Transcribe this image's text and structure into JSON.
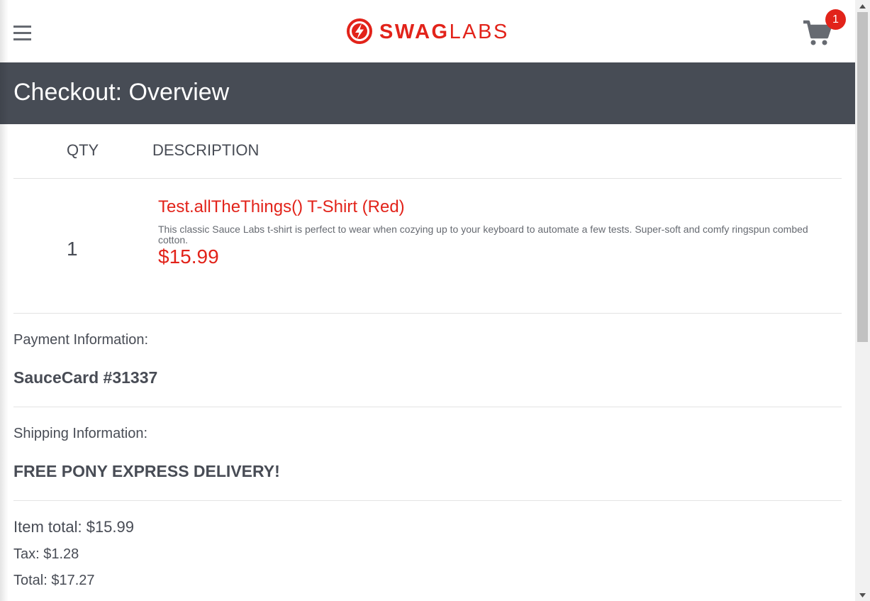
{
  "header": {
    "logo": {
      "text_bold": "SWAG",
      "text_light": "LABS"
    },
    "cart_count": "1"
  },
  "page_title": "Checkout: Overview",
  "columns": {
    "qty": "QTY",
    "description": "DESCRIPTION"
  },
  "items": [
    {
      "qty": "1",
      "name": "Test.allTheThings() T-Shirt (Red)",
      "description": "This classic Sauce Labs t-shirt is perfect to wear when cozying up to your keyboard to automate a few tests. Super-soft and comfy ringspun combed cotton.",
      "price": "$15.99"
    }
  ],
  "payment": {
    "label": "Payment Information:",
    "value": "SauceCard #31337"
  },
  "shipping": {
    "label": "Shipping Information:",
    "value": "FREE PONY EXPRESS DELIVERY!"
  },
  "summary": {
    "item_total": "Item total: $15.99",
    "tax": "Tax: $1.28",
    "total": "Total: $17.27"
  },
  "colors": {
    "brand_red": "#e2231a",
    "header_dark": "#474c55",
    "text": "#484c55"
  },
  "icons": [
    "hamburger-menu-icon",
    "swag-labs-logo-icon",
    "shopping-cart-icon"
  ]
}
